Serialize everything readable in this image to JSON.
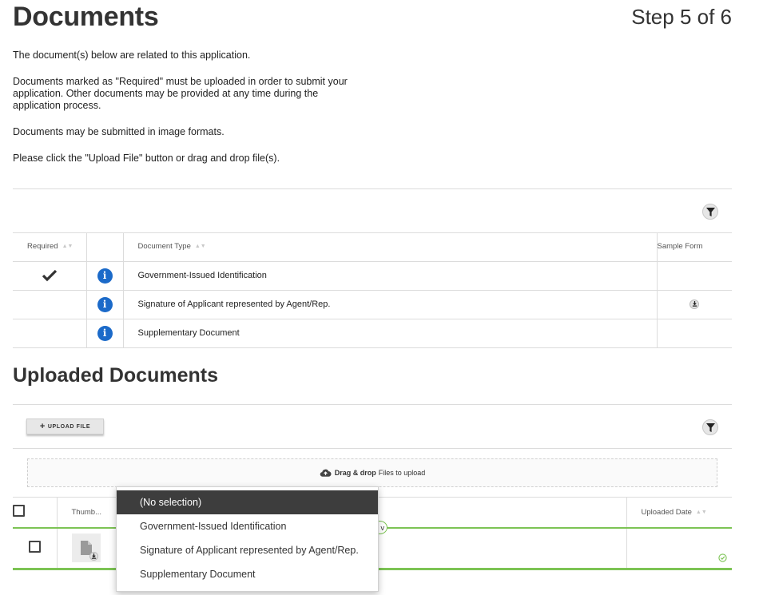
{
  "header": {
    "title": "Documents",
    "step": "Step 5 of 6"
  },
  "intro": {
    "p1": "The document(s) below are related to this application.",
    "p2": "Documents marked as \"Required\" must be uploaded in order to submit your application. Other documents may be provided at any time during the application process.",
    "p3": "Documents may be submitted in image formats.",
    "p4": "Please click the \"Upload File\" button or drag and drop file(s)."
  },
  "required_table": {
    "headers": {
      "required": "Required",
      "document_type": "Document Type",
      "sample_form": "Sample Form"
    },
    "rows": [
      {
        "document_type": "Government-Issued Identification",
        "required": true,
        "sample": false
      },
      {
        "document_type": "Signature of Applicant represented by Agent/Rep.",
        "required": false,
        "sample": true
      },
      {
        "document_type": "Supplementary Document",
        "required": false,
        "sample": false
      }
    ],
    "info_glyph": "i"
  },
  "uploaded": {
    "title": "Uploaded Documents",
    "upload_button": "UPLOAD FILE",
    "upload_plus": "+",
    "dropzone_bold": "Drag & drop",
    "dropzone_text": "Files to upload",
    "headers": {
      "thumbnail": "Thumb...",
      "uploaded_date": "Uploaded Date"
    },
    "partial_tag": "v"
  },
  "dropdown": {
    "options": [
      "(No selection)",
      "Government-Issued Identification",
      "Signature of Applicant represented by Agent/Rep.",
      "Supplementary Document"
    ],
    "selected": "(No selection)"
  },
  "colors": {
    "accent_green": "#7cc354",
    "info_blue": "#1b6ac9",
    "selected_bg": "#3d3d3d"
  },
  "icons": [
    "filter-icon",
    "checkmark-icon",
    "info-icon",
    "download-icon",
    "cloud-upload-icon",
    "file-icon",
    "success-check-icon"
  ]
}
